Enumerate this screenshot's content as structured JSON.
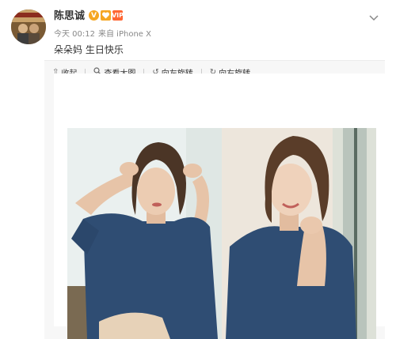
{
  "post": {
    "username": "陈思诚",
    "time": "今天 00:12",
    "source": "来自 iPhone X",
    "text": "朵朵妈 生日快乐"
  },
  "badges": {
    "vip_label": "VIP"
  },
  "toolbar": {
    "collapse_label": "收起",
    "view_large_label": "查看大图",
    "rotate_left_label": "向左旋转",
    "rotate_right_label": "向右旋转"
  },
  "icons": {
    "collapse": "arrow-up-icon",
    "view_large": "magnifier-icon",
    "rotate_left": "rotate-left-icon",
    "rotate_right": "rotate-right-icon",
    "menu": "chevron-down-icon"
  },
  "colors": {
    "accent": "#f5a623",
    "vip": "#ff6633",
    "shirt": "#2f4d73",
    "toolbar_bg": "#f7f7f7"
  }
}
